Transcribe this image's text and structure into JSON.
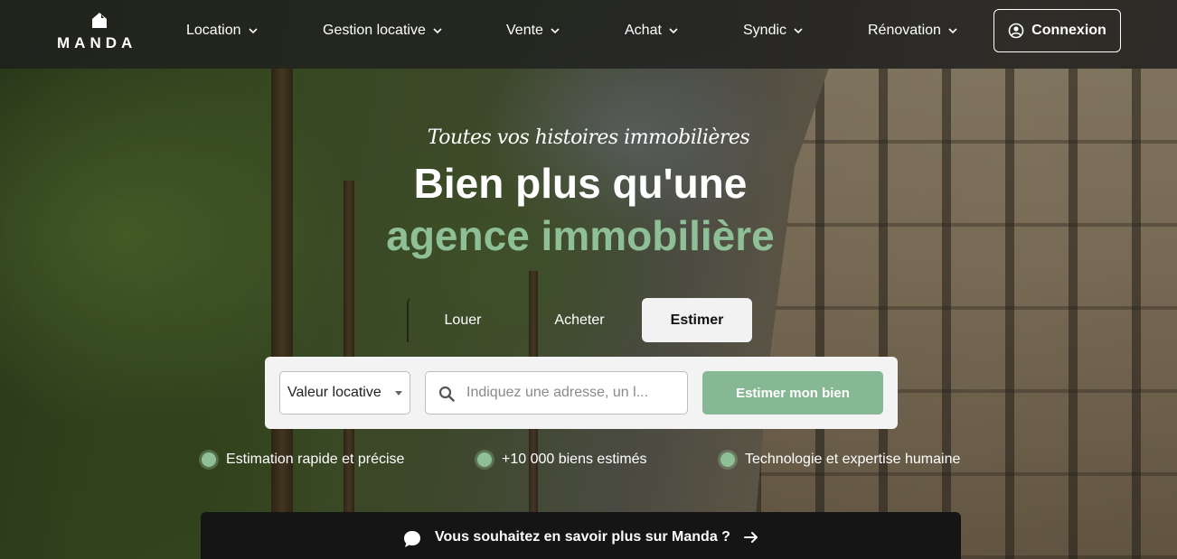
{
  "brand": {
    "name": "MANDA",
    "accent": "#8fbf96",
    "button_green": "#86b893"
  },
  "nav": {
    "items": [
      {
        "label": "Location"
      },
      {
        "label": "Gestion locative"
      },
      {
        "label": "Vente"
      },
      {
        "label": "Achat"
      },
      {
        "label": "Syndic"
      },
      {
        "label": "Rénovation"
      }
    ],
    "login_label": "Connexion",
    "login_icon": "user-circle-icon"
  },
  "hero": {
    "tagline": "Toutes vos histoires immobilières",
    "title_line1": "Bien plus qu'une",
    "title_line2": "agence immobilière"
  },
  "tabs": {
    "items": [
      {
        "label": "Louer"
      },
      {
        "label": "Acheter"
      },
      {
        "label": "Estimer",
        "active": true
      }
    ]
  },
  "search": {
    "select_value": "Valeur locative",
    "address_placeholder": "Indiquez une adresse, un l...",
    "address_value": "",
    "submit_label": "Estimer mon bien"
  },
  "features": [
    {
      "label": "Estimation rapide et précise"
    },
    {
      "label": "+10 000 biens estimés"
    },
    {
      "label": "Technologie et expertise humaine"
    }
  ],
  "info_bar": {
    "label": "Vous souhaitez en savoir plus sur Manda ?",
    "icon": "chat-bubble-icon",
    "arrow_icon": "arrow-right-icon"
  }
}
